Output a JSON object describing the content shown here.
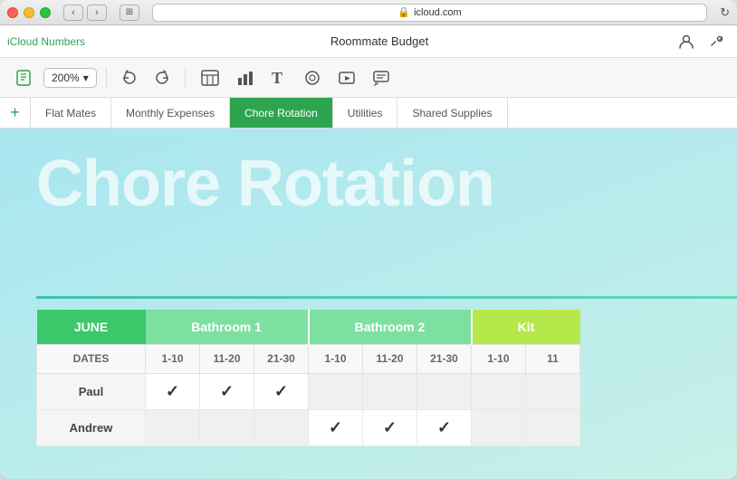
{
  "window": {
    "url": "icloud.com",
    "title": "Roommate Budget",
    "app": "iCloud Numbers"
  },
  "toolbar": {
    "zoom": "200%",
    "zoom_chevron": "▾"
  },
  "tabs": [
    {
      "id": "flat-mates",
      "label": "Flat Mates",
      "active": false
    },
    {
      "id": "monthly-expenses",
      "label": "Monthly Expenses",
      "active": false
    },
    {
      "id": "chore-rotation",
      "label": "Chore Rotation",
      "active": true
    },
    {
      "id": "utilities",
      "label": "Utilities",
      "active": false
    },
    {
      "id": "shared-supplies",
      "label": "Shared Supplies",
      "active": false
    }
  ],
  "sheet": {
    "big_title": "Chore Rotation",
    "table": {
      "header": {
        "col1": "JUNE",
        "col2": "Bathroom 1",
        "col3": "Bathroom 2",
        "col4": "Kit"
      },
      "subheader": {
        "dates_label": "DATES",
        "ranges": [
          "1-10",
          "11-20",
          "21-30",
          "1-10",
          "11-20",
          "21-30",
          "1-10",
          "11"
        ]
      },
      "rows": [
        {
          "name": "Paul",
          "b1_110": "✓",
          "b1_1120": "✓",
          "b1_2130": "✓",
          "b2_110": "",
          "b2_1120": "",
          "b2_2130": "",
          "kit_110": "",
          "kit_11": ""
        },
        {
          "name": "Andrew",
          "b1_110": "",
          "b1_1120": "",
          "b1_2130": "",
          "b2_110": "✓",
          "b2_1120": "✓",
          "b2_2130": "✓",
          "kit_110": "",
          "kit_11": ""
        }
      ]
    }
  }
}
